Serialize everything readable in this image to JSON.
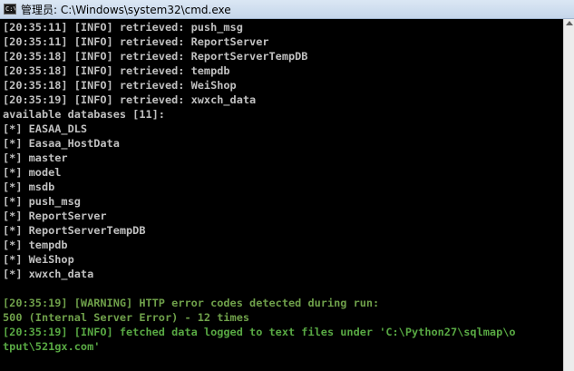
{
  "window": {
    "title": "管理员: C:\\Windows\\system32\\cmd.exe",
    "icon": "cmd-icon",
    "icon_text": "C:\\"
  },
  "console": {
    "lines": [
      {
        "text": "[20:35:11] [INFO] retrieved: push_msg",
        "color": "#c0c0c0"
      },
      {
        "text": "[20:35:11] [INFO] retrieved: ReportServer",
        "color": "#c0c0c0"
      },
      {
        "text": "[20:35:18] [INFO] retrieved: ReportServerTempDB",
        "color": "#c0c0c0"
      },
      {
        "text": "[20:35:18] [INFO] retrieved: tempdb",
        "color": "#c0c0c0"
      },
      {
        "text": "[20:35:18] [INFO] retrieved: WeiShop",
        "color": "#c0c0c0"
      },
      {
        "text": "[20:35:19] [INFO] retrieved: xwxch_data",
        "color": "#c0c0c0"
      },
      {
        "text": "available databases [11]:",
        "color": "#c0c0c0"
      },
      {
        "text": "[*] EASAA_DLS",
        "color": "#c0c0c0"
      },
      {
        "text": "[*] Easaa_HostData",
        "color": "#c0c0c0"
      },
      {
        "text": "[*] master",
        "color": "#c0c0c0"
      },
      {
        "text": "[*] model",
        "color": "#c0c0c0"
      },
      {
        "text": "[*] msdb",
        "color": "#c0c0c0"
      },
      {
        "text": "[*] push_msg",
        "color": "#c0c0c0"
      },
      {
        "text": "[*] ReportServer",
        "color": "#c0c0c0"
      },
      {
        "text": "[*] ReportServerTempDB",
        "color": "#c0c0c0"
      },
      {
        "text": "[*] tempdb",
        "color": "#c0c0c0"
      },
      {
        "text": "[*] WeiShop",
        "color": "#c0c0c0"
      },
      {
        "text": "[*] xwxch_data",
        "color": "#c0c0c0"
      },
      {
        "text": "",
        "color": "#c0c0c0"
      },
      {
        "text": "[20:35:19] [WARNING] HTTP error codes detected during run:",
        "color": "#6fa04a"
      },
      {
        "text": "500 (Internal Server Error) - 12 times",
        "color": "#6fa04a"
      },
      {
        "text": "[20:35:19] [INFO] fetched data logged to text files under 'C:\\Python27\\sqlmap\\o",
        "color": "#58a843"
      },
      {
        "text": "tput\\521gx.com'",
        "color": "#58a843"
      }
    ]
  },
  "scrollbar": {
    "icon": "scroll-up-arrow-icon"
  }
}
